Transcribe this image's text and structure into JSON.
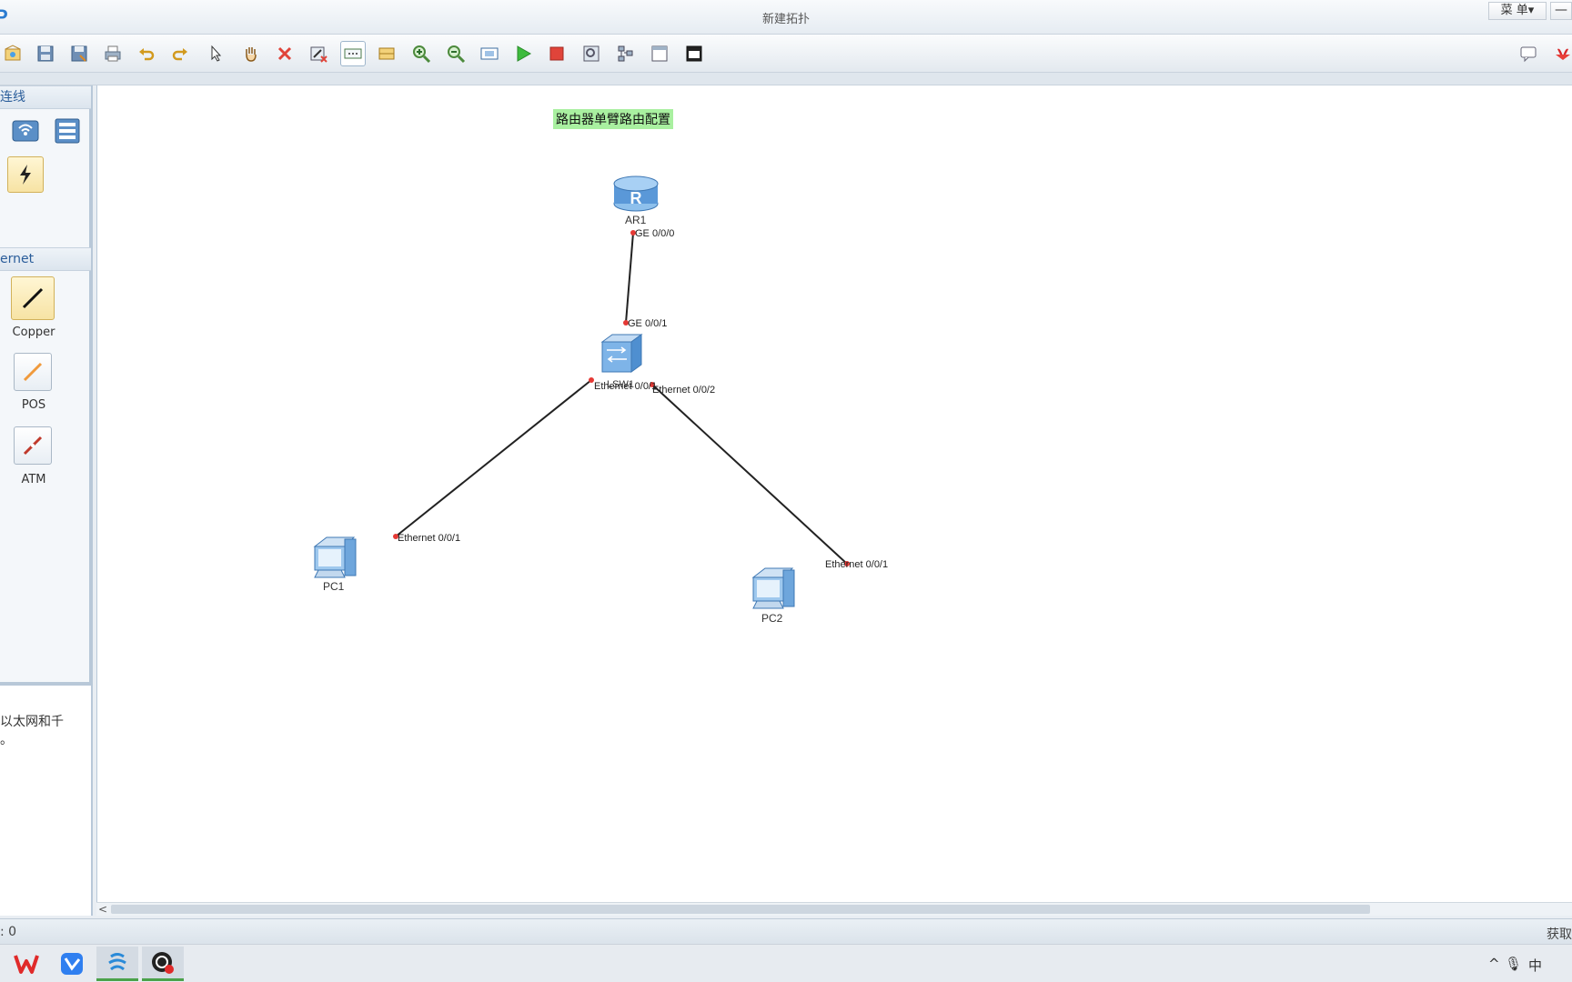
{
  "window": {
    "logo": "P",
    "title": "新建拓扑",
    "menu_label": "菜 单▾",
    "minimize_label": "—"
  },
  "toolbar": {
    "tools": [
      "new-topology",
      "save",
      "save-as",
      "print",
      "undo",
      "redo",
      "select",
      "pan",
      "delete",
      "delete-connection",
      "text-note",
      "palette",
      "zoom-in",
      "zoom-out",
      "fit-view",
      "start-device",
      "stop-device",
      "capture",
      "topology-grid",
      "show-hide-panel",
      "console"
    ]
  },
  "left_panel": {
    "section_connections": "连线",
    "section_ethernet": "ernet",
    "cables": [
      {
        "label": "Copper",
        "color": "#111111"
      },
      {
        "label": "POS",
        "color": "#f09a3c"
      },
      {
        "label": "ATM",
        "color": "#c0392b"
      }
    ],
    "description": "以太网和千\n。"
  },
  "canvas": {
    "label": "路由器单臂路由配置",
    "devices": [
      {
        "name": "AR1",
        "type": "router"
      },
      {
        "name": "LSW1",
        "type": "switch"
      },
      {
        "name": "PC1",
        "type": "pc"
      },
      {
        "name": "PC2",
        "type": "pc"
      }
    ],
    "ports": {
      "ar1_ge000": "GE 0/0/0",
      "lsw_ge001": "GE 0/0/1",
      "lsw_eth001": "Ethernet 0/0/1",
      "lsw_eth002": "Ethernet 0/0/2",
      "pc1_eth001": "Ethernet 0/0/1",
      "pc2_eth001": "Ethernet 0/0/1"
    },
    "link_color": "#222222",
    "port_dot_color": "#e53935"
  },
  "statusbar": {
    "left": ": 0",
    "right": "获取"
  },
  "taskbar": {
    "apps": [
      "wps",
      "feishu",
      "ensp",
      "obs"
    ],
    "tray_ime": "中",
    "tray_caret": "^"
  }
}
